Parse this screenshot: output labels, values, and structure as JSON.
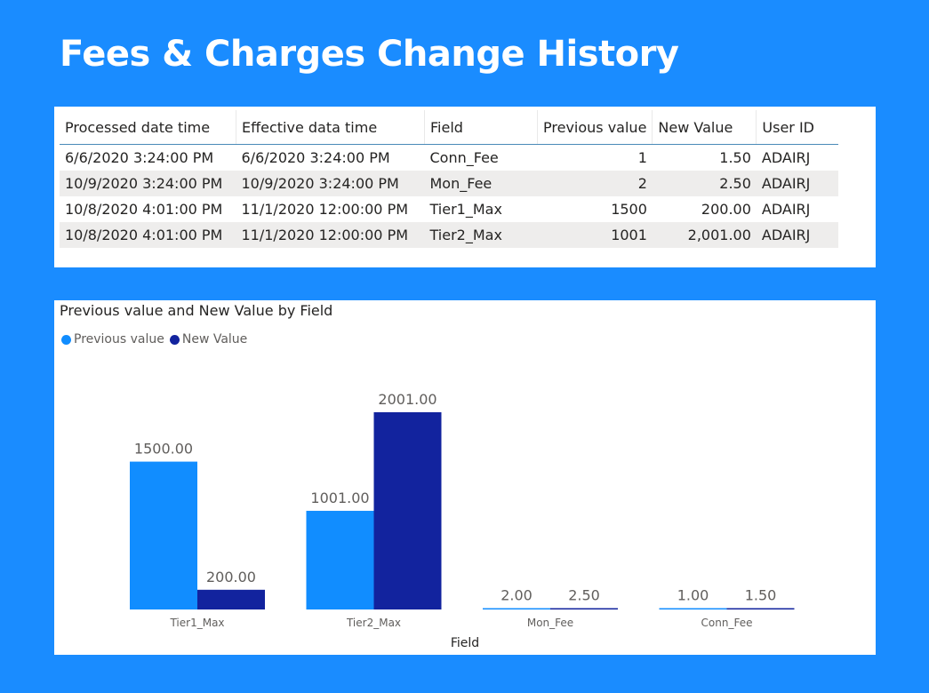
{
  "page": {
    "title": "Fees & Charges Change History",
    "background_color": "#1a8cff"
  },
  "table": {
    "columns": [
      "Processed date time",
      "Effective data time",
      "Field",
      "Previous value",
      "New Value",
      "User ID"
    ],
    "rows": [
      [
        "6/6/2020 3:24:00 PM",
        "6/6/2020 3:24:00 PM",
        "Conn_Fee",
        "1",
        "1.50",
        "ADAIRJ"
      ],
      [
        "10/9/2020 3:24:00 PM",
        "10/9/2020 3:24:00 PM",
        "Mon_Fee",
        "2",
        "2.50",
        "ADAIRJ"
      ],
      [
        "10/8/2020 4:01:00 PM",
        "11/1/2020 12:00:00 PM",
        "Tier1_Max",
        "1500",
        "200.00",
        "ADAIRJ"
      ],
      [
        "10/8/2020 4:01:00 PM",
        "11/1/2020 12:00:00 PM",
        "Tier2_Max",
        "1001",
        "2,001.00",
        "ADAIRJ"
      ]
    ]
  },
  "chart_data": {
    "type": "bar",
    "title": "Previous value and New Value by Field",
    "xlabel": "Field",
    "ylabel": "",
    "categories": [
      "Tier1_Max",
      "Tier2_Max",
      "Mon_Fee",
      "Conn_Fee"
    ],
    "series": [
      {
        "name": "Previous value",
        "values": [
          1500,
          1001,
          2,
          1
        ],
        "labels": [
          "1500.00",
          "1001.00",
          "2.00",
          "1.00"
        ],
        "color": "#118dff"
      },
      {
        "name": "New Value",
        "values": [
          200,
          2001,
          2.5,
          1.5
        ],
        "labels": [
          "200.00",
          "2001.00",
          "2.50",
          "1.50"
        ],
        "color": "#12239e"
      }
    ],
    "ylim": [
      0,
      2001
    ],
    "legend_position": "top-left",
    "grid": false
  }
}
